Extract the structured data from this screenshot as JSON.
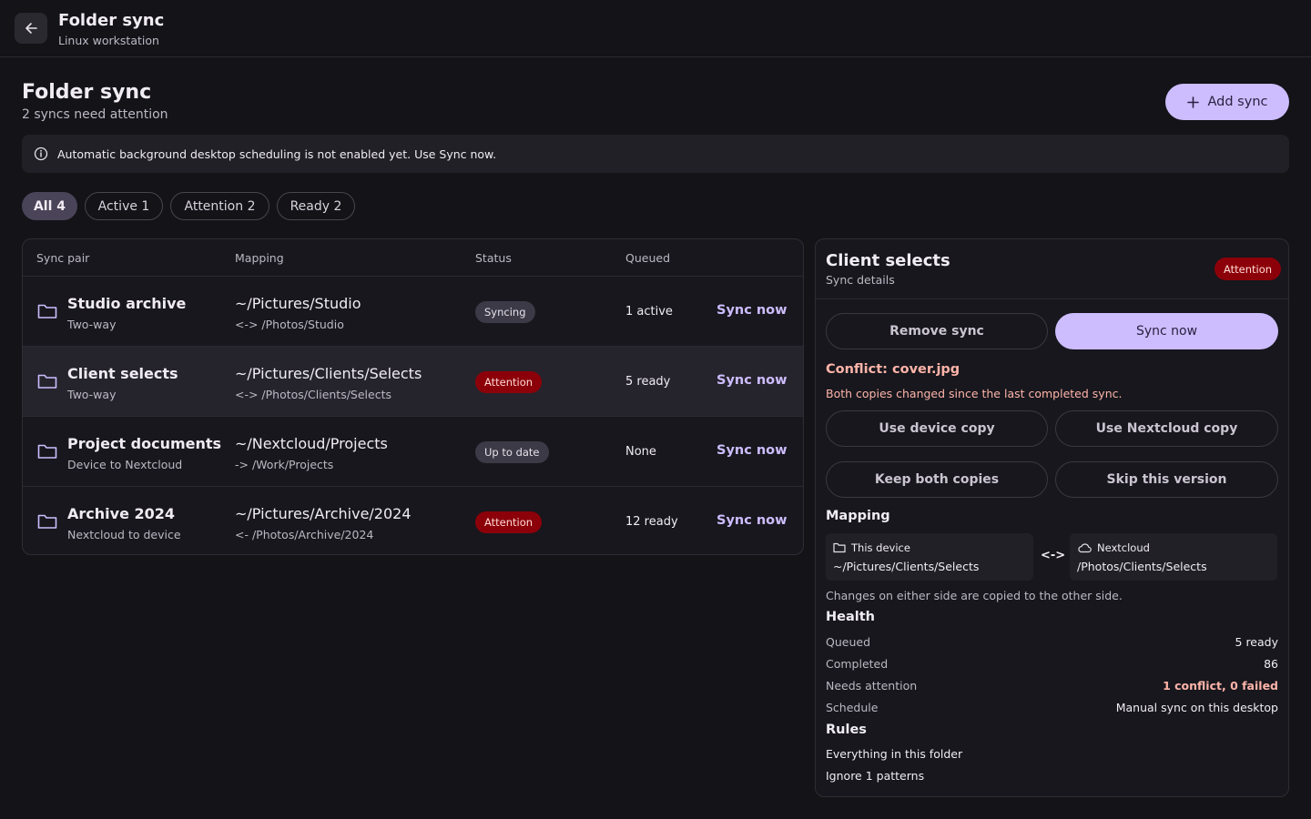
{
  "topbar": {
    "title": "Folder sync",
    "subtitle": "Linux workstation",
    "back_icon": "arrow-left-icon"
  },
  "page": {
    "title": "Folder sync",
    "subtitle": "2 syncs need attention",
    "add_label": "Add sync"
  },
  "info": {
    "text": "Automatic background desktop scheduling is not enabled yet. Use Sync now."
  },
  "filters": [
    {
      "label": "All 4",
      "selected": true
    },
    {
      "label": "Active 1",
      "selected": false
    },
    {
      "label": "Attention 2",
      "selected": false
    },
    {
      "label": "Ready 2",
      "selected": false
    }
  ],
  "table": {
    "headers": [
      "Sync pair",
      "Mapping",
      "Status",
      "Queued"
    ],
    "rows": [
      {
        "name": "Studio archive",
        "direction": "Two-way",
        "local": "~/Pictures/Studio",
        "remote": "<-> /Photos/Studio",
        "status": "Syncing",
        "queued": "1 active",
        "action": "Sync now"
      },
      {
        "name": "Client selects",
        "direction": "Two-way",
        "local": "~/Pictures/Clients/Selects",
        "remote": "<-> /Photos/Clients/Selects",
        "status": "Attention",
        "queued": "5 ready",
        "action": "Sync now"
      },
      {
        "name": "Project documents",
        "direction": "Device to Nextcloud",
        "local": "~/Nextcloud/Projects",
        "remote": "-> /Work/Projects",
        "status": "Up to date",
        "queued": "None",
        "action": "Sync now"
      },
      {
        "name": "Archive 2024",
        "direction": "Nextcloud to device",
        "local": "~/Pictures/Archive/2024",
        "remote": "<- /Photos/Archive/2024",
        "status": "Attention",
        "queued": "12 ready",
        "action": "Sync now"
      }
    ]
  },
  "details": {
    "title": "Client selects",
    "subtitle": "Sync details",
    "badge": "Attention",
    "remove_label": "Remove sync",
    "sync_label": "Sync now",
    "conflict_title": "Conflict: cover.jpg",
    "conflict_desc": "Both copies changed since the last completed sync.",
    "resolve": {
      "device": "Use device copy",
      "nextcloud": "Use Nextcloud copy",
      "both": "Keep both copies",
      "skip": "Skip this version"
    },
    "mapping": {
      "title": "Mapping",
      "local_label": "This device",
      "local_path": "~/Pictures/Clients/Selects",
      "arrow": "<->",
      "remote_label": "Nextcloud",
      "remote_path": "/Photos/Clients/Selects",
      "desc": "Changes on either side are copied to the other side."
    },
    "health": {
      "title": "Health",
      "queued_label": "Queued",
      "queued_value": "5 ready",
      "completed_label": "Completed",
      "completed_value": "86",
      "attention_label": "Needs attention",
      "attention_value": "1 conflict, 0 failed",
      "schedule_label": "Schedule",
      "schedule_value": "Manual sync on this desktop"
    },
    "rules": {
      "title": "Rules",
      "scope": "Everything in this folder",
      "ignore": "Ignore 1 patterns"
    }
  },
  "colors": {
    "background": "#131318",
    "accent": "#cdbdff",
    "attention_bg": "#8c0009",
    "attention_text": "#ffdad6",
    "warning_text": "#ffb4a9"
  }
}
